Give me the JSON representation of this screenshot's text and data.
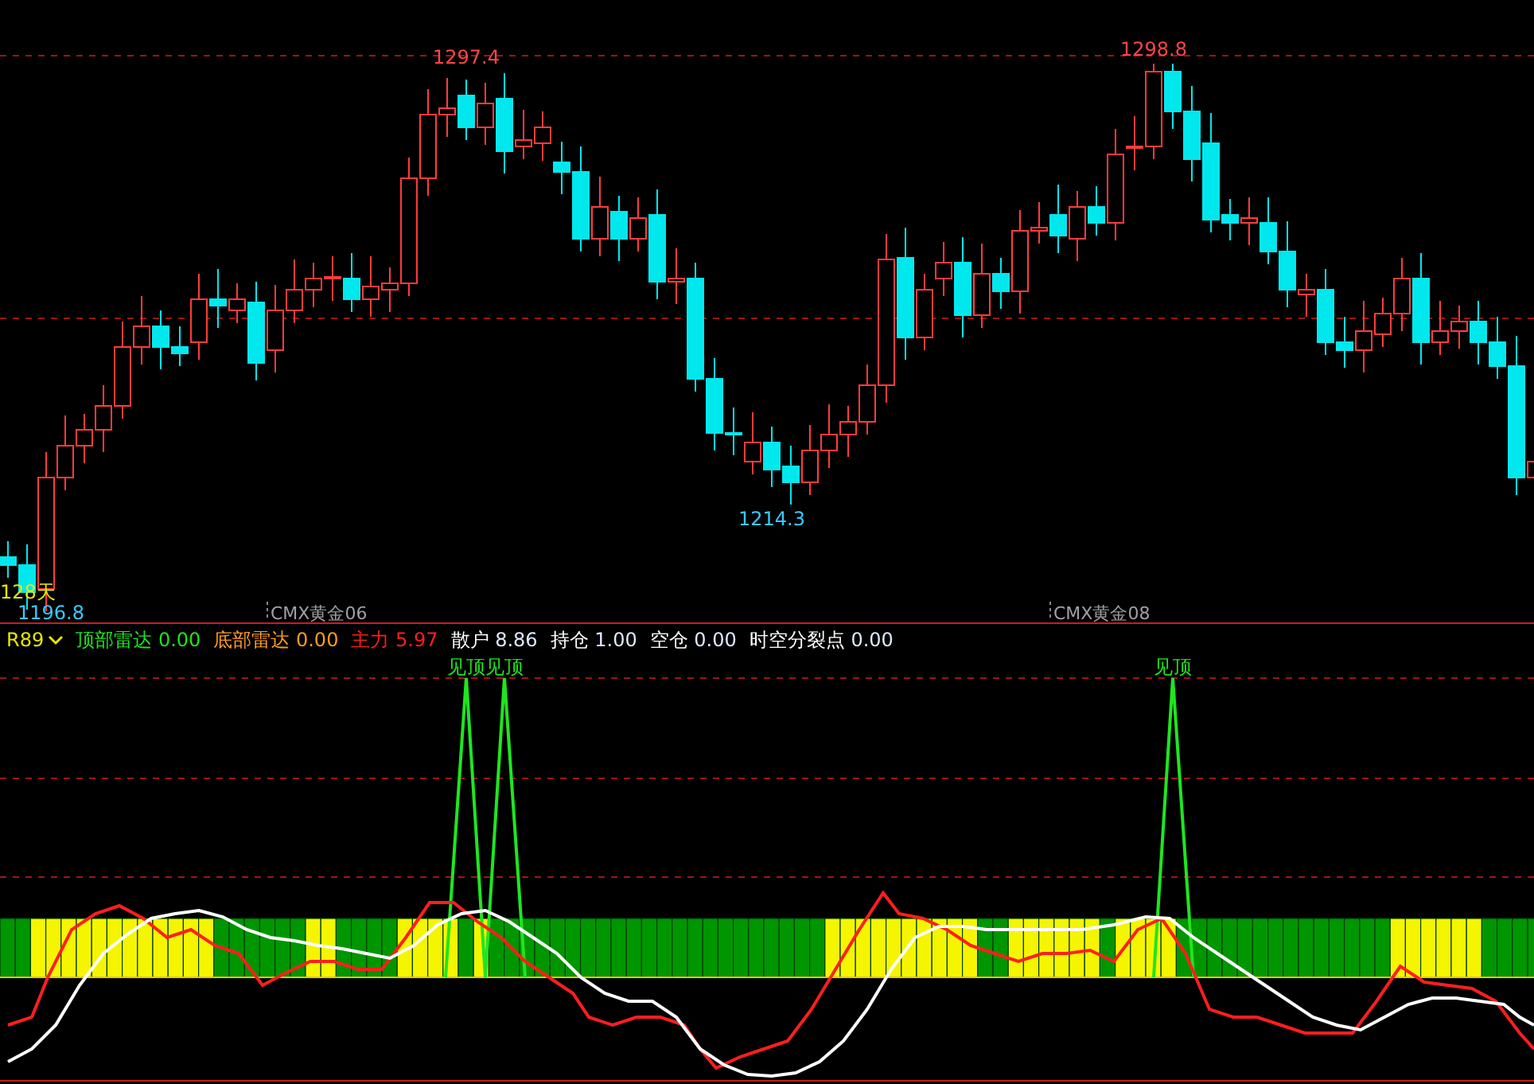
{
  "price_chart": {
    "price_labels": [
      {
        "text": "1297.4",
        "kind": "high"
      },
      {
        "text": "1214.3",
        "kind": "low"
      },
      {
        "text": "1298.8",
        "kind": "high"
      },
      {
        "text": "1196.8",
        "kind": "low"
      }
    ],
    "period_label": "128天",
    "contract_labels": [
      "CMX黄金06",
      "CMX黄金08"
    ]
  },
  "indicator": {
    "name": "R89",
    "values": [
      {
        "label": "顶部雷达",
        "value": "0.00",
        "color": "#1ee61e"
      },
      {
        "label": "底部雷达",
        "value": "0.00",
        "color": "#ff9c1e"
      },
      {
        "label": "主力",
        "value": "5.97",
        "color": "#ff1e1e"
      },
      {
        "label": "散户",
        "value": "8.86",
        "color": "#ffffff"
      },
      {
        "label": "持仓",
        "value": "1.00",
        "color": "#ffffff"
      },
      {
        "label": "空仓",
        "value": "0.00",
        "color": "#ffffff"
      },
      {
        "label": "时空分裂点",
        "value": "0.00",
        "color": "#ffffff"
      }
    ],
    "signals": [
      "见顶",
      "见顶",
      "见顶"
    ]
  }
}
